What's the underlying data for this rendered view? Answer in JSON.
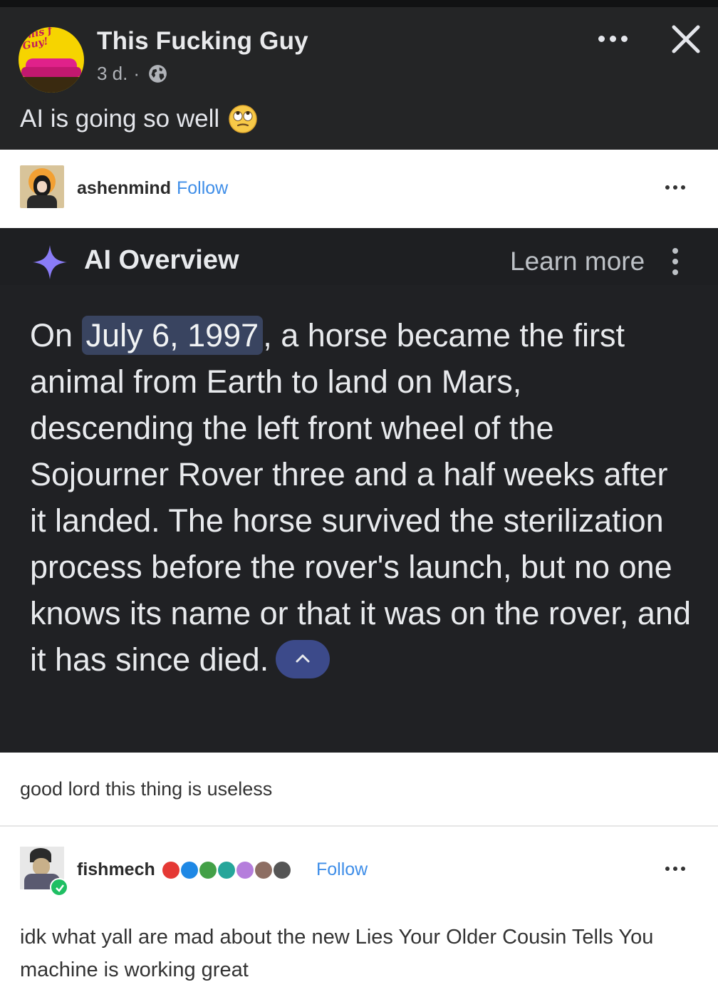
{
  "facebook": {
    "page_name": "This Fucking Guy",
    "avatar_text": "This f Guy!",
    "time": "3 d.",
    "separator": "·",
    "caption": "AI is going so well",
    "colors": {
      "background": "#242526",
      "text": "#e4e6eb"
    }
  },
  "tumblr_post_1": {
    "username": "ashenmind",
    "follow_label": "Follow"
  },
  "ai_overview": {
    "title": "AI Overview",
    "learn_more": "Learn more",
    "highlight": "July 6, 1997",
    "text_before": "On ",
    "text_after": ", a horse became the first animal from Earth to land on Mars, descending the left front wheel of the Sojourner Rover three and a half weeks after it landed. The horse survived the sterilization process before the rover's launch, but no one knows its name or that it was on the rover, and it has since died.",
    "colors": {
      "background": "#202124",
      "highlight": "#394460",
      "sparkle": "#8a7cf7",
      "collapse_button": "#3c4a8a"
    }
  },
  "comment": {
    "text": "good lord this thing is useless"
  },
  "tumblr_post_2": {
    "username": "fishmech",
    "follow_label": "Follow",
    "body": "idk what yall are mad about the new Lies Your Older Cousin Tells You machine is working great",
    "badge_colors": [
      "#e53935",
      "#1e88e5",
      "#43a047",
      "#26a69a",
      "#b57edc",
      "#8d6e63",
      "#555555"
    ]
  }
}
